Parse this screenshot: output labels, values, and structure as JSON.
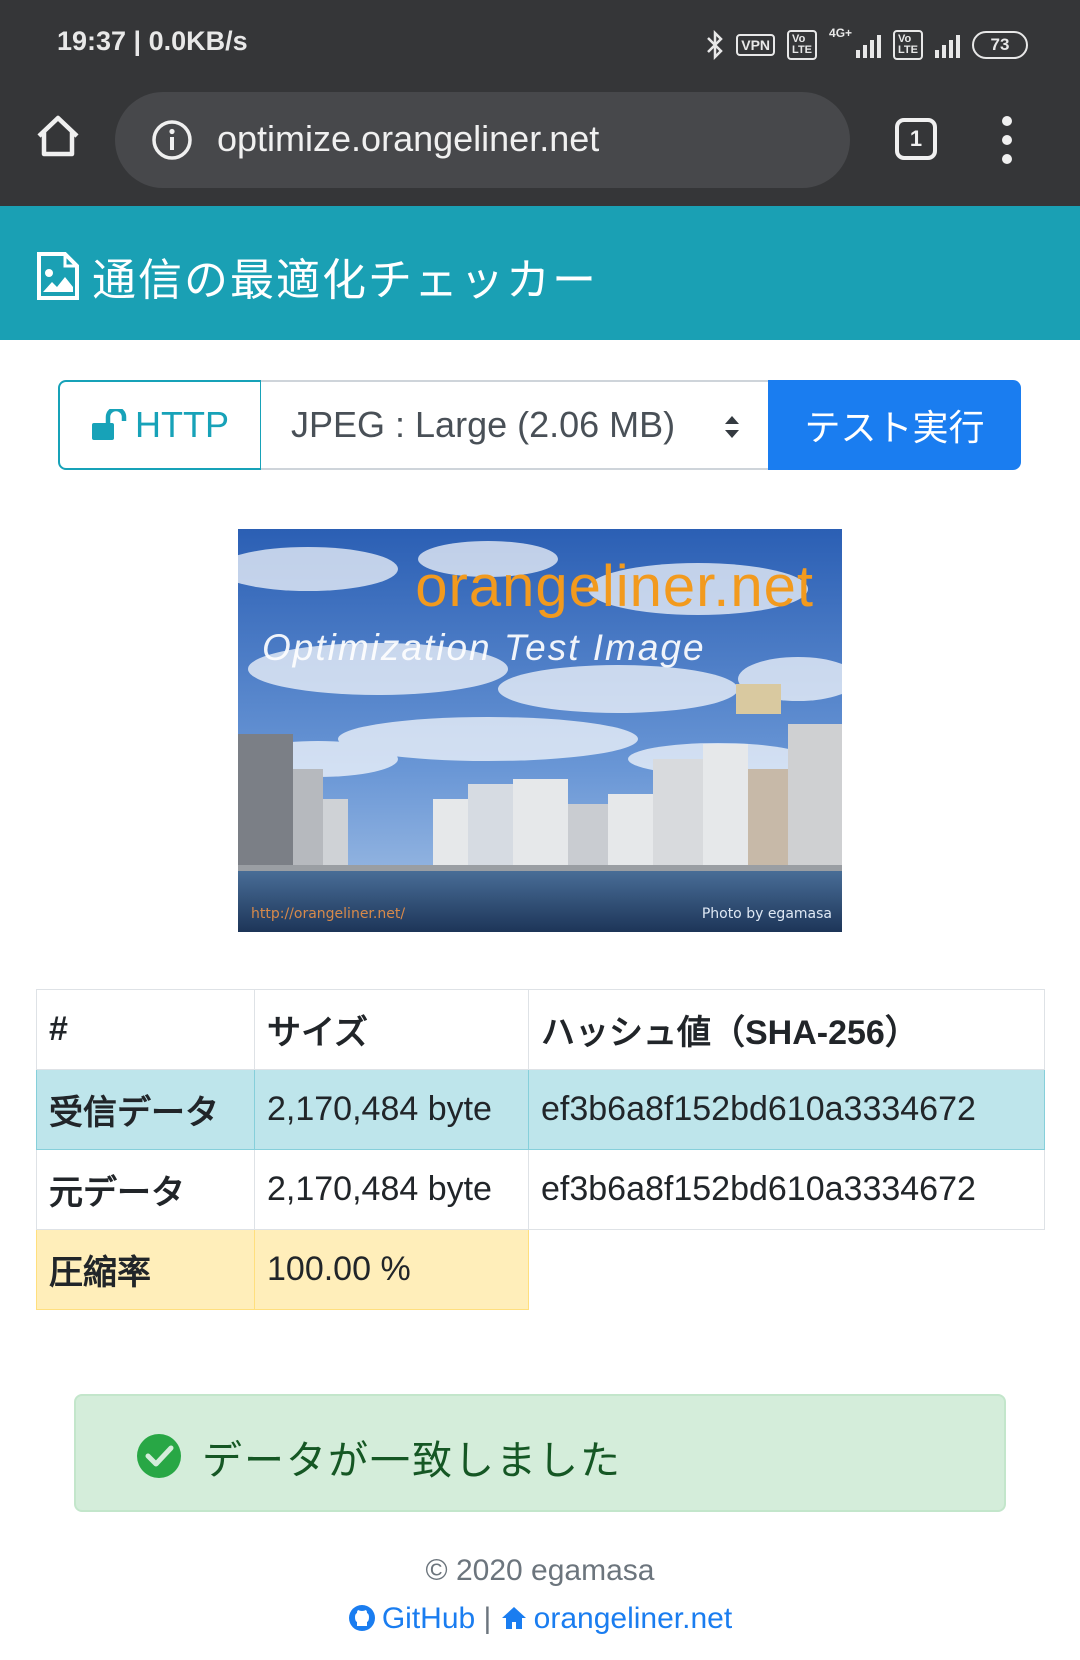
{
  "status_bar": {
    "time": "19:37 | 0.0KB/s",
    "vpn": "VPN",
    "volte": "Vo LTE",
    "network": "4G+",
    "battery": "73"
  },
  "browser": {
    "url": "optimize.orangeliner.net",
    "tab_count": "1"
  },
  "header": {
    "title": "通信の最適化チェッカー"
  },
  "controls": {
    "protocol_label": "HTTP",
    "selected_size": "JPEG : Large (2.06 MB)",
    "run_label": "テスト実行"
  },
  "test_image": {
    "brand": "orangeliner.net",
    "subtitle": "Optimization Test Image",
    "url": "http://orangeliner.net/",
    "credit": "Photo by egamasa"
  },
  "table": {
    "headers": [
      "#",
      "サイズ",
      "ハッシュ値（SHA-256）"
    ],
    "rows": [
      {
        "label": "受信データ",
        "size": "2,170,484 byte",
        "hash": "ef3b6a8f152bd610a3334672"
      },
      {
        "label": "元データ",
        "size": "2,170,484 byte",
        "hash": "ef3b6a8f152bd610a3334672"
      },
      {
        "label": "圧縮率",
        "size": "100.00 %"
      }
    ]
  },
  "alert": {
    "message": "データが一致しました"
  },
  "footer": {
    "copyright": "© 2020 egamasa",
    "github": "GitHub",
    "separator": "|",
    "site": "orangeliner.net"
  },
  "colors": {
    "chrome": "#353638",
    "header": "#1aa0b4",
    "primary": "#1a7df0",
    "info_row": "#bee5eb",
    "warning_row": "#ffeeba",
    "success_bg": "#d4edda",
    "success_text": "#155724"
  }
}
